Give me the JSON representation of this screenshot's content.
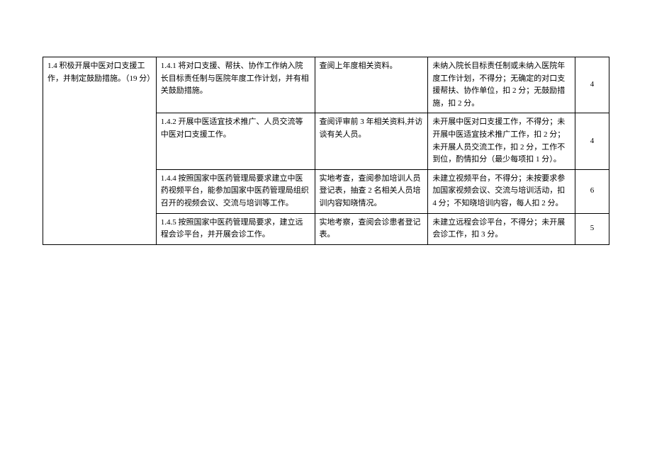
{
  "table": {
    "col1_header": "1.4 积极开展中医对口支援工作，并制定鼓励措施。（19 分）",
    "rows": [
      {
        "c2": "1.4.1 将对口支援、帮扶、协作工作纳入院长目标责任制与医院年度工作计划，并有相关鼓励措施。",
        "c3": "查阅上年度相关资料。",
        "c4": "未纳入院长目标责任制或未纳入医院年度工作计划，不得分；无确定的对口支援帮扶、协作单位，扣 2 分；无鼓励措施，扣 2 分。",
        "c5": "4"
      },
      {
        "c2": "1.4.2 开展中医适宜技术推广、人员交流等中医对口支援工作。",
        "c3": "查阅评审前 3 年相关资料,并访谈有关人员。",
        "c4": "未开展中医对口支援工作，不得分；未开展中医适宜技术推广工作，扣 2 分；未开展人员交流工作，扣 2 分，工作不到位，酌情扣分（最少每项扣 1 分）。",
        "c5": "4"
      },
      {
        "c2": "1.4.4 按照国家中医药管理局要求建立中医药视频平台，能参加国家中医药管理局组织召开的视频会议、交流与培训等工作。",
        "c3": "实地考查，查阅参加培训人员登记表，抽查 2 名相关人员培训内容知晓情况。",
        "c4": "未建立视频平台，不得分；未按要求参加国家视频会议、交流与培训活动，扣 4 分；不知晓培训内容，每人扣 2 分。",
        "c5": "6"
      },
      {
        "c2": "1.4.5 按照国家中医药管理局要求，建立远程会诊平台，并开展会诊工作。",
        "c3": "实地考察，查阅会诊患者登记表。",
        "c4": "未建立远程会诊平台，不得分；未开展会诊工作，扣 3 分。",
        "c5": "5"
      }
    ]
  }
}
